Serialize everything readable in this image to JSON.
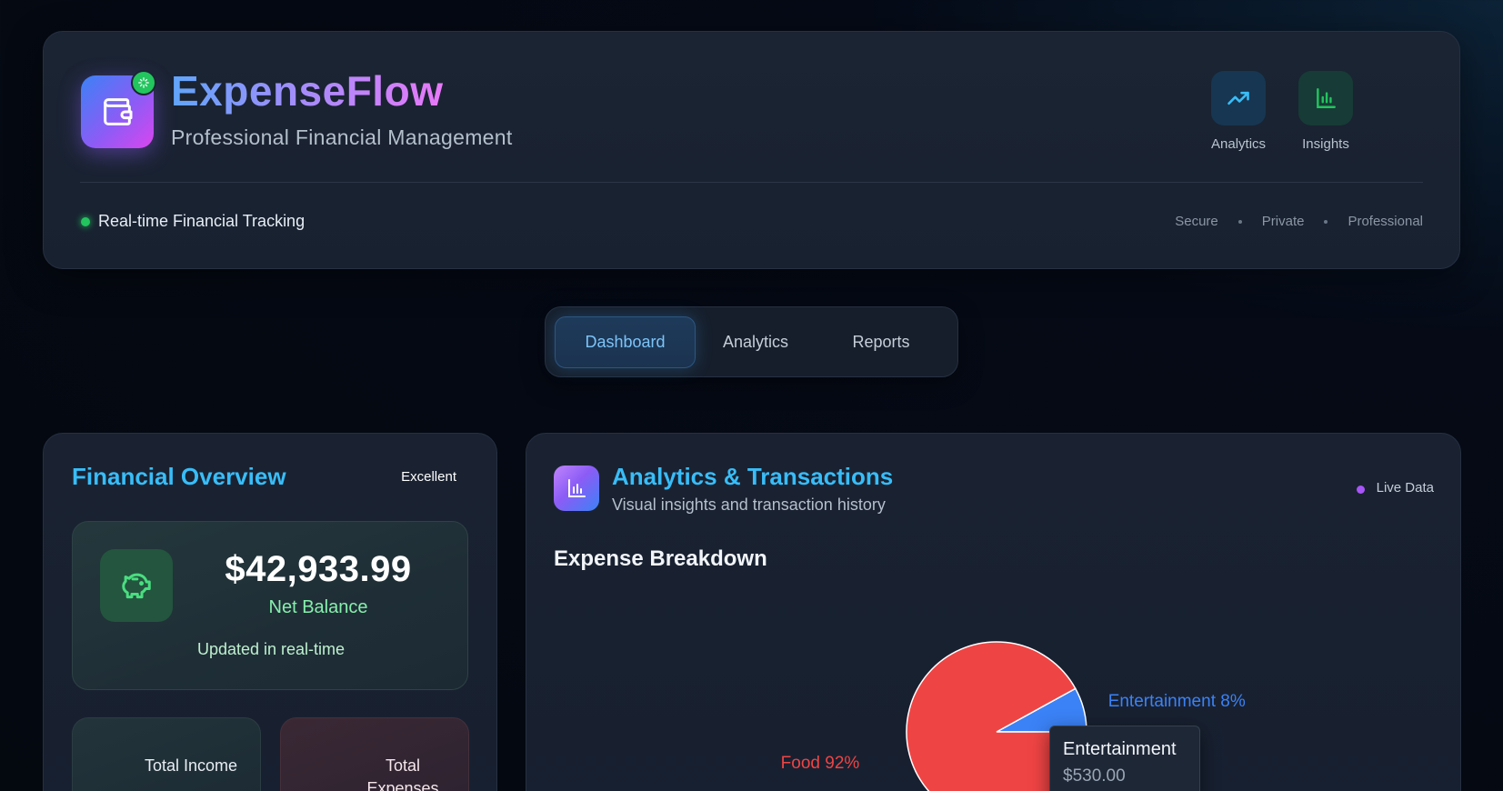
{
  "header": {
    "title": "ExpenseFlow",
    "subtitle": "Professional Financial Management",
    "actions": [
      {
        "label": "Analytics",
        "icon": "trending-up-icon"
      },
      {
        "label": "Insights",
        "icon": "bar-chart-icon"
      }
    ],
    "status": "Real-time Financial Tracking",
    "tags": [
      "Secure",
      "Private",
      "Professional"
    ]
  },
  "tabs": [
    {
      "label": "Dashboard",
      "active": true
    },
    {
      "label": "Analytics",
      "active": false
    },
    {
      "label": "Reports",
      "active": false
    }
  ],
  "overview": {
    "title": "Financial Overview",
    "badge": "Excellent",
    "balance": "$42,933.99",
    "balance_label": "Net Balance",
    "updated": "Updated in real-time",
    "income_label": "Total Income",
    "expenses_label": "Total Expenses"
  },
  "analytics": {
    "title": "Analytics & Transactions",
    "subtitle": "Visual insights and transaction history",
    "live": "Live Data",
    "chart_title": "Expense Breakdown",
    "tooltip_name": "Entertainment",
    "tooltip_value": "$530.00"
  },
  "chart_data": {
    "type": "pie",
    "title": "Expense Breakdown",
    "slices": [
      {
        "name": "Food",
        "percent": 92,
        "label": "Food 92%",
        "color": "#ef4444"
      },
      {
        "name": "Entertainment",
        "percent": 8,
        "label": "Entertainment 8%",
        "color": "#3b82f6"
      }
    ]
  },
  "colors": {
    "accent": "#38bdf8",
    "success": "#22c55e",
    "live": "#a855f7"
  }
}
